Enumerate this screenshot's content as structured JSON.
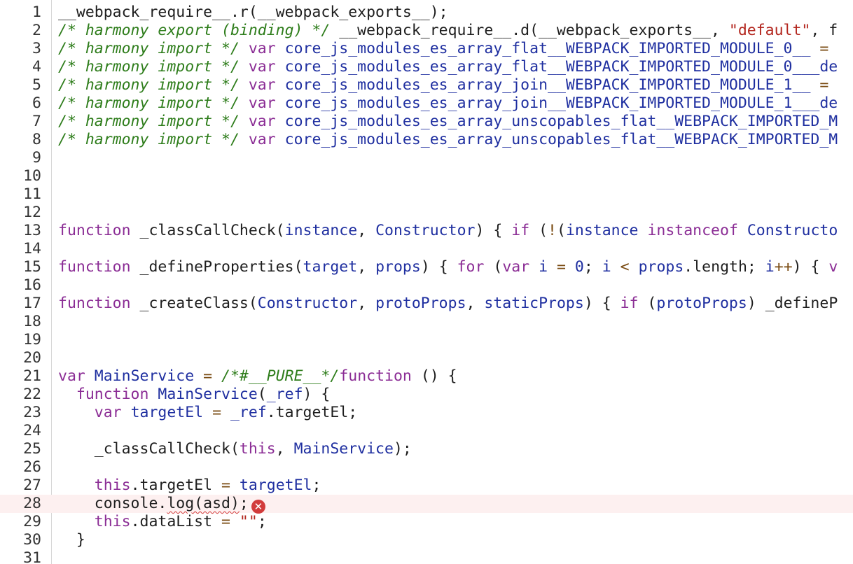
{
  "editor": {
    "error_icon_glyph": "✕",
    "colors": {
      "comment": "#2e7d1b",
      "keyword": "#8b2d95",
      "identifier": "#1f2fa0",
      "string": "#b3261e",
      "error": "#d23b3b",
      "error_line_bg": "#fdf0f0"
    },
    "lines": [
      {
        "n": "1",
        "tokens": [
          {
            "t": "__webpack_require__.r(__webpack_exports__);",
            "c": "plain"
          }
        ]
      },
      {
        "n": "2",
        "tokens": [
          {
            "t": "/* harmony export (binding) */",
            "c": "comment"
          },
          {
            "t": " __webpack_require__.d(__webpack_exports__, ",
            "c": "plain"
          },
          {
            "t": "\"default\"",
            "c": "string"
          },
          {
            "t": ", f",
            "c": "plain"
          }
        ]
      },
      {
        "n": "3",
        "tokens": [
          {
            "t": "/* harmony import */",
            "c": "comment"
          },
          {
            "t": " ",
            "c": "plain"
          },
          {
            "t": "var",
            "c": "keyword"
          },
          {
            "t": " core_js_modules_es_array_flat__WEBPACK_IMPORTED_MODULE_0__ ",
            "c": "ident"
          },
          {
            "t": "=",
            "c": "op"
          }
        ]
      },
      {
        "n": "4",
        "tokens": [
          {
            "t": "/* harmony import */",
            "c": "comment"
          },
          {
            "t": " ",
            "c": "plain"
          },
          {
            "t": "var",
            "c": "keyword"
          },
          {
            "t": " core_js_modules_es_array_flat__WEBPACK_IMPORTED_MODULE_0___de",
            "c": "ident"
          }
        ]
      },
      {
        "n": "5",
        "tokens": [
          {
            "t": "/* harmony import */",
            "c": "comment"
          },
          {
            "t": " ",
            "c": "plain"
          },
          {
            "t": "var",
            "c": "keyword"
          },
          {
            "t": " core_js_modules_es_array_join__WEBPACK_IMPORTED_MODULE_1__ ",
            "c": "ident"
          },
          {
            "t": "=",
            "c": "op"
          }
        ]
      },
      {
        "n": "6",
        "tokens": [
          {
            "t": "/* harmony import */",
            "c": "comment"
          },
          {
            "t": " ",
            "c": "plain"
          },
          {
            "t": "var",
            "c": "keyword"
          },
          {
            "t": " core_js_modules_es_array_join__WEBPACK_IMPORTED_MODULE_1___de",
            "c": "ident"
          }
        ]
      },
      {
        "n": "7",
        "tokens": [
          {
            "t": "/* harmony import */",
            "c": "comment"
          },
          {
            "t": " ",
            "c": "plain"
          },
          {
            "t": "var",
            "c": "keyword"
          },
          {
            "t": " core_js_modules_es_array_unscopables_flat__WEBPACK_IMPORTED_M",
            "c": "ident"
          }
        ]
      },
      {
        "n": "8",
        "tokens": [
          {
            "t": "/* harmony import */",
            "c": "comment"
          },
          {
            "t": " ",
            "c": "plain"
          },
          {
            "t": "var",
            "c": "keyword"
          },
          {
            "t": " core_js_modules_es_array_unscopables_flat__WEBPACK_IMPORTED_M",
            "c": "ident"
          }
        ]
      },
      {
        "n": "9",
        "tokens": []
      },
      {
        "n": "10",
        "tokens": []
      },
      {
        "n": "11",
        "tokens": []
      },
      {
        "n": "12",
        "tokens": []
      },
      {
        "n": "13",
        "tokens": [
          {
            "t": "function",
            "c": "keyword"
          },
          {
            "t": " _classCallCheck",
            "c": "plain"
          },
          {
            "t": "(",
            "c": "plain"
          },
          {
            "t": "instance",
            "c": "ident"
          },
          {
            "t": ", ",
            "c": "plain"
          },
          {
            "t": "Constructor",
            "c": "ident"
          },
          {
            "t": ") { ",
            "c": "plain"
          },
          {
            "t": "if",
            "c": "keyword"
          },
          {
            "t": " (",
            "c": "plain"
          },
          {
            "t": "!",
            "c": "op"
          },
          {
            "t": "(",
            "c": "plain"
          },
          {
            "t": "instance",
            "c": "ident"
          },
          {
            "t": " ",
            "c": "plain"
          },
          {
            "t": "instanceof",
            "c": "keyword"
          },
          {
            "t": " Constructo",
            "c": "ident"
          }
        ]
      },
      {
        "n": "14",
        "tokens": []
      },
      {
        "n": "15",
        "tokens": [
          {
            "t": "function",
            "c": "keyword"
          },
          {
            "t": " _defineProperties",
            "c": "plain"
          },
          {
            "t": "(",
            "c": "plain"
          },
          {
            "t": "target",
            "c": "ident"
          },
          {
            "t": ", ",
            "c": "plain"
          },
          {
            "t": "props",
            "c": "ident"
          },
          {
            "t": ") { ",
            "c": "plain"
          },
          {
            "t": "for",
            "c": "keyword"
          },
          {
            "t": " (",
            "c": "plain"
          },
          {
            "t": "var",
            "c": "keyword"
          },
          {
            "t": " ",
            "c": "plain"
          },
          {
            "t": "i",
            "c": "ident"
          },
          {
            "t": " = ",
            "c": "op"
          },
          {
            "t": "0",
            "c": "num"
          },
          {
            "t": "; ",
            "c": "plain"
          },
          {
            "t": "i",
            "c": "ident"
          },
          {
            "t": " < ",
            "c": "op"
          },
          {
            "t": "props",
            "c": "ident"
          },
          {
            "t": ".length; ",
            "c": "plain"
          },
          {
            "t": "i",
            "c": "ident"
          },
          {
            "t": "++",
            "c": "op"
          },
          {
            "t": ") { ",
            "c": "plain"
          },
          {
            "t": "v",
            "c": "keyword"
          }
        ]
      },
      {
        "n": "16",
        "tokens": []
      },
      {
        "n": "17",
        "tokens": [
          {
            "t": "function",
            "c": "keyword"
          },
          {
            "t": " _createClass",
            "c": "plain"
          },
          {
            "t": "(",
            "c": "plain"
          },
          {
            "t": "Constructor",
            "c": "ident"
          },
          {
            "t": ", ",
            "c": "plain"
          },
          {
            "t": "protoProps",
            "c": "ident"
          },
          {
            "t": ", ",
            "c": "plain"
          },
          {
            "t": "staticProps",
            "c": "ident"
          },
          {
            "t": ") { ",
            "c": "plain"
          },
          {
            "t": "if",
            "c": "keyword"
          },
          {
            "t": " (",
            "c": "plain"
          },
          {
            "t": "protoProps",
            "c": "ident"
          },
          {
            "t": ") _defineP",
            "c": "plain"
          }
        ]
      },
      {
        "n": "18",
        "tokens": []
      },
      {
        "n": "19",
        "tokens": []
      },
      {
        "n": "20",
        "tokens": []
      },
      {
        "n": "21",
        "tokens": [
          {
            "t": "var",
            "c": "keyword"
          },
          {
            "t": " ",
            "c": "plain"
          },
          {
            "t": "MainService",
            "c": "ident"
          },
          {
            "t": " = ",
            "c": "op"
          },
          {
            "t": "/*#__PURE__*/",
            "c": "comment"
          },
          {
            "t": "function",
            "c": "keyword"
          },
          {
            "t": " () {",
            "c": "plain"
          }
        ]
      },
      {
        "n": "22",
        "tokens": [
          {
            "t": "  ",
            "c": "plain"
          },
          {
            "t": "function",
            "c": "keyword"
          },
          {
            "t": " ",
            "c": "plain"
          },
          {
            "t": "MainService",
            "c": "ident"
          },
          {
            "t": "(",
            "c": "plain"
          },
          {
            "t": "_ref",
            "c": "ident"
          },
          {
            "t": ") {",
            "c": "plain"
          }
        ]
      },
      {
        "n": "23",
        "tokens": [
          {
            "t": "    ",
            "c": "plain"
          },
          {
            "t": "var",
            "c": "keyword"
          },
          {
            "t": " ",
            "c": "plain"
          },
          {
            "t": "targetEl",
            "c": "ident"
          },
          {
            "t": " = ",
            "c": "op"
          },
          {
            "t": "_ref",
            "c": "ident"
          },
          {
            "t": ".targetEl;",
            "c": "plain"
          }
        ]
      },
      {
        "n": "24",
        "tokens": []
      },
      {
        "n": "25",
        "tokens": [
          {
            "t": "    _classCallCheck(",
            "c": "plain"
          },
          {
            "t": "this",
            "c": "keyword"
          },
          {
            "t": ", ",
            "c": "plain"
          },
          {
            "t": "MainService",
            "c": "ident"
          },
          {
            "t": ");",
            "c": "plain"
          }
        ]
      },
      {
        "n": "26",
        "tokens": []
      },
      {
        "n": "27",
        "tokens": [
          {
            "t": "    ",
            "c": "plain"
          },
          {
            "t": "this",
            "c": "keyword"
          },
          {
            "t": ".targetEl ",
            "c": "plain"
          },
          {
            "t": "=",
            "c": "op"
          },
          {
            "t": " ",
            "c": "plain"
          },
          {
            "t": "targetEl",
            "c": "ident"
          },
          {
            "t": ";",
            "c": "plain"
          }
        ]
      },
      {
        "n": "28",
        "error": true,
        "tokens": [
          {
            "t": "    console.",
            "c": "plain"
          },
          {
            "t": "log(asd)",
            "c": "plain",
            "squiggle": true
          },
          {
            "t": ";",
            "c": "plain"
          }
        ]
      },
      {
        "n": "29",
        "tokens": [
          {
            "t": "    ",
            "c": "plain"
          },
          {
            "t": "this",
            "c": "keyword"
          },
          {
            "t": ".dataList ",
            "c": "plain"
          },
          {
            "t": "=",
            "c": "op"
          },
          {
            "t": " ",
            "c": "plain"
          },
          {
            "t": "\"\"",
            "c": "string"
          },
          {
            "t": ";",
            "c": "plain"
          }
        ]
      },
      {
        "n": "30",
        "tokens": [
          {
            "t": "  }",
            "c": "plain"
          }
        ]
      },
      {
        "n": "31",
        "tokens": []
      }
    ]
  }
}
